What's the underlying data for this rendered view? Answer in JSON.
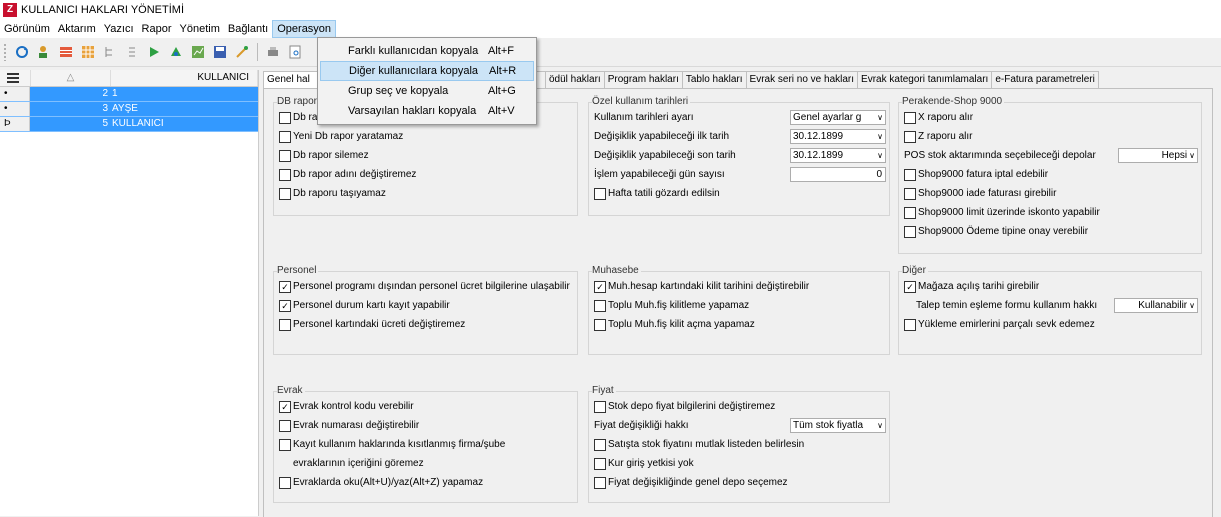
{
  "window": {
    "title": "KULLANICI HAKLARI YÖNETİMİ",
    "app_icon": "Z"
  },
  "menu": [
    "Görünüm",
    "Aktarım",
    "Yazıcı",
    "Rapor",
    "Yönetim",
    "Bağlantı",
    "Operasyon"
  ],
  "dropdown": [
    {
      "label": "Farklı kullanıcıdan kopyala",
      "shortcut": "Alt+F"
    },
    {
      "label": "Diğer kullanıcılara kopyala",
      "shortcut": "Alt+R"
    },
    {
      "label": "Grup seç ve kopyala",
      "shortcut": "Alt+G"
    },
    {
      "label": "Varsayılan hakları kopyala",
      "shortcut": "Alt+V"
    }
  ],
  "grid": {
    "headers": [
      "",
      "△",
      "KULLANICI"
    ],
    "rows": [
      {
        "ind": "•",
        "num": "2",
        "name": "1"
      },
      {
        "ind": "•",
        "num": "3",
        "name": "AYŞE"
      },
      {
        "ind": "Þ",
        "num": "5",
        "name": "KULLANICI"
      }
    ]
  },
  "tabs": [
    "Genel hal",
    "",
    "ödül hakları",
    "Program hakları",
    "Tablo hakları",
    "Evrak seri no ve hakları",
    "Evrak kategori tanımlamaları",
    "e-Fatura parametreleri"
  ],
  "groups": {
    "db": {
      "title": "DB rapor",
      "items": [
        {
          "label": "Db ra",
          "checked": false
        },
        {
          "label": "Yeni Db rapor yaratamaz",
          "checked": false
        },
        {
          "label": "Db rapor silemez",
          "checked": false
        },
        {
          "label": "Db rapor adını değiştiremez",
          "checked": false
        },
        {
          "label": "Db raporu taşıyamaz",
          "checked": false
        }
      ]
    },
    "ozel": {
      "title": "Özel kullanım tarihleri",
      "ayar_label": "Kullanım tarihleri ayarı",
      "ayar_value": "Genel ayarlar g",
      "ilk_label": "Değişiklik yapabileceği ilk tarih",
      "ilk_value": "30.12.1899",
      "son_label": "Değişiklik yapabileceği son tarih",
      "son_value": "30.12.1899",
      "gun_label": "İşlem yapabileceği gün sayısı",
      "gun_value": "0",
      "hafta": {
        "label": "Hafta tatili gözardı edilsin",
        "checked": false
      }
    },
    "perakende": {
      "title": "Perakende-Shop 9000",
      "x": {
        "label": "X raporu alır",
        "checked": false
      },
      "z": {
        "label": "Z raporu alır",
        "checked": false
      },
      "pos_label": "POS stok aktarımında seçebileceği depolar",
      "pos_value": "Hepsi",
      "items": [
        {
          "label": "Shop9000 fatura iptal edebilir",
          "checked": false
        },
        {
          "label": "Shop9000 iade faturası girebilir",
          "checked": false
        },
        {
          "label": "Shop9000 limit üzerinde iskonto yapabilir",
          "checked": false
        },
        {
          "label": "Shop9000 Ödeme tipine onay verebilir",
          "checked": false
        }
      ]
    },
    "personel": {
      "title": "Personel",
      "items": [
        {
          "label": "Personel programı dışından personel ücret bilgilerine ulaşabilir",
          "checked": true
        },
        {
          "label": "Personel durum kartı kayıt yapabilir",
          "checked": true
        },
        {
          "label": "Personel kartındaki ücreti değiştiremez",
          "checked": false
        }
      ]
    },
    "muhasebe": {
      "title": "Muhasebe",
      "items": [
        {
          "label": "Muh.hesap kartındaki kilit tarihini değiştirebilir",
          "checked": true
        },
        {
          "label": "Toplu Muh.fiş kilitleme yapamaz",
          "checked": false
        },
        {
          "label": "Toplu Muh.fiş kilit açma yapamaz",
          "checked": false
        }
      ]
    },
    "diger": {
      "title": "Diğer",
      "magaza": {
        "label": "Mağaza açılış tarihi girebilir",
        "checked": true
      },
      "talep_label": "Talep temin eşleme formu kullanım hakkı",
      "talep_value": "Kullanabilir",
      "yukleme": {
        "label": "Yükleme emirlerini parçalı sevk edemez",
        "checked": false
      }
    },
    "evrak": {
      "title": "Evrak",
      "items": [
        {
          "label": "Evrak kontrol kodu verebilir",
          "checked": true
        },
        {
          "label": "Evrak numarası değiştirebilir",
          "checked": false
        },
        {
          "label": "Kayıt kullanım haklarında kısıtlanmış firma/şube",
          "checked": false
        }
      ],
      "continuation": "evraklarının içeriğini göremez",
      "last": {
        "label": "Evraklarda oku(Alt+U)/yaz(Alt+Z) yapamaz",
        "checked": false
      }
    },
    "fiyat": {
      "title": "Fiyat",
      "stok": {
        "label": "Stok depo fiyat bilgilerini değiştiremez",
        "checked": false
      },
      "hak_label": "Fiyat değişikliği hakkı",
      "hak_value": "Tüm stok fiyatla",
      "items": [
        {
          "label": "Satışta stok fiyatını mutlak listeden belirlesin",
          "checked": false
        },
        {
          "label": "Kur giriş yetkisi yok",
          "checked": false
        },
        {
          "label": "Fiyat değişikliğinde genel depo seçemez",
          "checked": false
        }
      ]
    }
  },
  "check_mark": "✓",
  "arrow": "∨"
}
